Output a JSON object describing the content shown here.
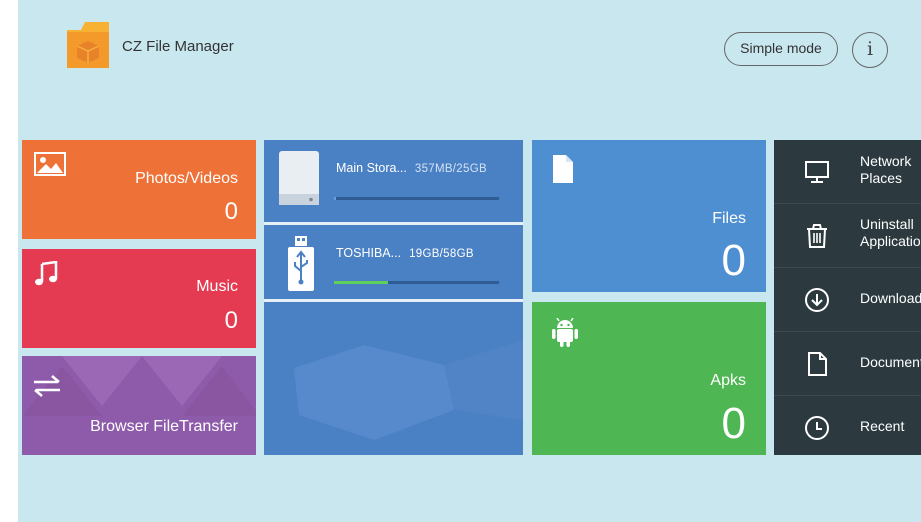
{
  "app": {
    "title": "CZ File Manager"
  },
  "header": {
    "mode_button": "Simple mode",
    "info_button": "i"
  },
  "tiles": {
    "photos": {
      "label": "Photos/Videos",
      "count": "0"
    },
    "music": {
      "label": "Music",
      "count": "0"
    },
    "transfer": {
      "label": "Browser FileTransfer"
    },
    "files": {
      "label": "Files",
      "count": "0"
    },
    "apks": {
      "label": "Apks",
      "count": "0"
    }
  },
  "storage": [
    {
      "name": "Main Stora...",
      "size": "357MB/25GB",
      "progress": 0.01
    },
    {
      "name": "TOSHIBA...",
      "size": "19GB/58GB",
      "progress": 0.33
    }
  ],
  "menu": [
    {
      "label": "Network Places",
      "icon": "monitor-icon"
    },
    {
      "label": "Uninstall Applications",
      "icon": "trash-icon"
    },
    {
      "label": "Downloads",
      "icon": "download-icon"
    },
    {
      "label": "Documents",
      "icon": "document-icon"
    },
    {
      "label": "Recent",
      "icon": "clock-icon"
    }
  ],
  "colors": {
    "background": "#c9e7ef",
    "photos": "#ee7138",
    "music": "#e43b52",
    "transfer": "#8e5bab",
    "storage": "#4a80c4",
    "files": "#4e8fd2",
    "apks": "#4eb653",
    "menu": "#2c3a40",
    "usb_progress": "#5fd15a"
  }
}
